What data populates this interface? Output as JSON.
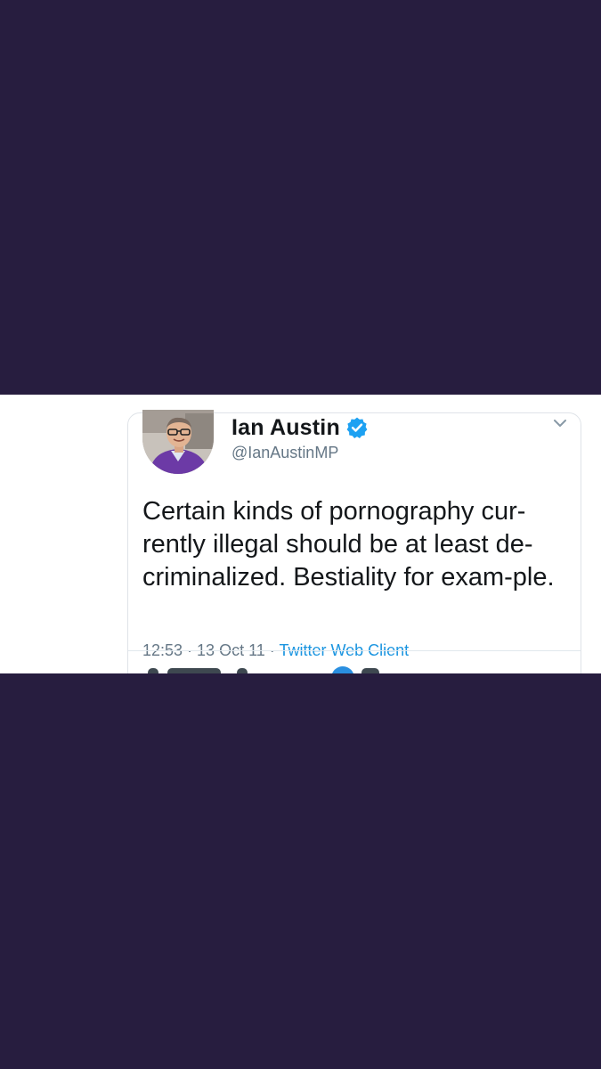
{
  "colors": {
    "background": "#271d3f",
    "card": "#ffffff",
    "text": "#14171a",
    "muted": "#657786",
    "link": "#1b95e0",
    "verified": "#1da1f2",
    "avatar_sweater": "#6c3aa6"
  },
  "tweet": {
    "author_name": "Ian Austin",
    "handle": "@IanAustinMP",
    "verified_icon": "verified-badge-icon",
    "menu_icon": "chevron-down-icon",
    "text": "Certain kinds of pornography cur-rently illegal should be at least de-criminalized. Bestiality for exam-ple.",
    "timestamp": "12:53 · 13 Oct 11",
    "separator": " · ",
    "source": "Twitter Web Client"
  }
}
